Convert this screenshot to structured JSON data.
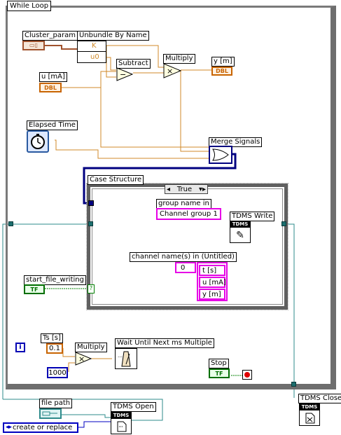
{
  "diagram": {
    "while_loop_label": "While Loop",
    "case_structure_label": "Case Structure",
    "case_selector_value": "True",
    "case_selector_left_arrow": "◂",
    "case_selector_right_arrow": "▾▸"
  },
  "nodes": {
    "cluster_param": {
      "label": "Cluster_param",
      "glyph": "▭▯"
    },
    "unbundle": {
      "label": "Unbundle By Name",
      "out_k": "K",
      "out_u0": "u0"
    },
    "u_ma": {
      "label": "u [mA]",
      "type": "DBL"
    },
    "subtract": {
      "label": "Subtract",
      "glyph": "−"
    },
    "multiply_top": {
      "label": "Multiply",
      "glyph": "×"
    },
    "y_m": {
      "label": "y [m]",
      "type": "DBL"
    },
    "elapsed_time": {
      "label": "Elapsed Time"
    },
    "merge_signals": {
      "label": "Merge Signals"
    },
    "group_name": {
      "label": "group name in",
      "value": "Channel group 1"
    },
    "tdms_write": {
      "label": "TDMS Write",
      "band": "TDMS",
      "glyph": "✎"
    },
    "channel_names": {
      "label": "channel name(s) in (Untitled)",
      "index": "0",
      "items": [
        "t [s]",
        "u [mA]",
        "y [m]"
      ]
    },
    "start_file_writing": {
      "label": "start_file_writing",
      "type": "TF",
      "mark": "?"
    },
    "iteration": {
      "glyph": "i"
    },
    "ts": {
      "label": "Ts [s]",
      "value": "0.1"
    },
    "multiply_bottom": {
      "label": "Multiply",
      "glyph": "×"
    },
    "const_1000": {
      "value": "1000"
    },
    "wait": {
      "label": "Wait Until Next ms Multiple"
    },
    "stop": {
      "label": "Stop",
      "type": "TF"
    },
    "file_path": {
      "label": "file path"
    },
    "tdms_open": {
      "label": "TDMS Open",
      "band": "TDMS"
    },
    "create_replace": {
      "value": "create or replace"
    },
    "tdms_close": {
      "label": "TDMS Close",
      "band": "TDMS"
    }
  },
  "colors": {
    "numeric_wire": "#d08a2a",
    "cluster_wire": "#a0522d",
    "refnum_wire": "#2e8b8b",
    "string_wire": "#ff66ff",
    "boolean_wire": "#008000",
    "enum_wire": "#0000c0",
    "dynamic_wire": "#000080"
  }
}
